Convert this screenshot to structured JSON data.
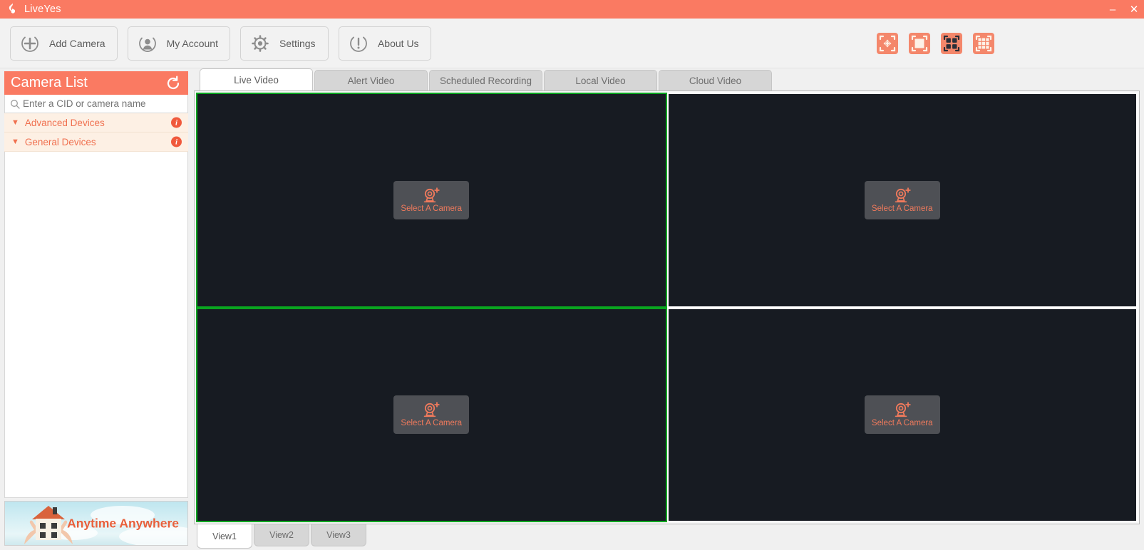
{
  "window": {
    "app_title": "LiveYes",
    "logo_icon": "flame-logo-icon",
    "minimize_label": "–",
    "close_label": "✕",
    "accent_color": "#fa7a62",
    "selected_border_color": "#0aa520",
    "panel_background": "#171b22"
  },
  "toolbar": {
    "buttons": [
      {
        "label": "Add Camera",
        "icon": "add-camera-icon"
      },
      {
        "label": "My Account",
        "icon": "user-account-icon"
      },
      {
        "label": "Settings",
        "icon": "gear-icon"
      },
      {
        "label": "About Us",
        "icon": "exclamation-info-icon"
      }
    ],
    "layout_icons": [
      {
        "name": "fullscreen-layout-icon",
        "selected": false
      },
      {
        "name": "single-view-layout-icon",
        "selected": false
      },
      {
        "name": "four-grid-layout-icon",
        "selected": true
      },
      {
        "name": "nine-grid-layout-icon",
        "selected": false
      }
    ]
  },
  "sidebar": {
    "title": "Camera List",
    "refresh_icon": "refresh-icon",
    "search": {
      "placeholder": "Enter a CID or camera name",
      "value": "",
      "icon": "search-icon"
    },
    "groups": [
      {
        "label": "Advanced Devices",
        "chevron": "▼",
        "info": "i"
      },
      {
        "label": "General Devices",
        "chevron": "▼",
        "info": "i"
      }
    ],
    "promo": {
      "text": "Anytime Anywhere",
      "image": "house-in-hands-sky-image"
    }
  },
  "main": {
    "tabs": [
      {
        "label": "Live Video",
        "active": true
      },
      {
        "label": "Alert Video",
        "active": false
      },
      {
        "label": "Scheduled Recording",
        "active": false
      },
      {
        "label": "Local Video",
        "active": false
      },
      {
        "label": "Cloud Video",
        "active": false
      }
    ],
    "cells": [
      {
        "label": "Select A Camera",
        "icon": "add-camera-webcam-icon",
        "selected": true
      },
      {
        "label": "Select A Camera",
        "icon": "add-camera-webcam-icon",
        "selected": false
      },
      {
        "label": "Select A Camera",
        "icon": "add-camera-webcam-icon",
        "selected": true
      },
      {
        "label": "Select A Camera",
        "icon": "add-camera-webcam-icon",
        "selected": false
      }
    ],
    "view_tabs": [
      {
        "label": "View1",
        "active": true
      },
      {
        "label": "View2",
        "active": false
      },
      {
        "label": "View3",
        "active": false
      }
    ]
  }
}
